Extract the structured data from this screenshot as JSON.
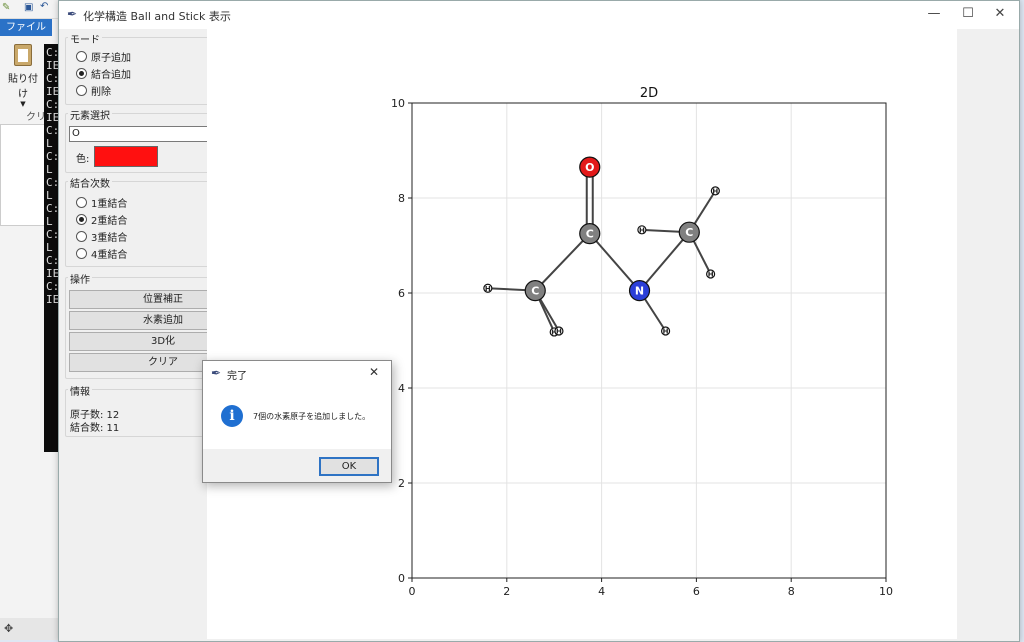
{
  "background_app": {
    "file_tab": "ファイル",
    "paste_label": "貼り付け",
    "clipboard_label": "クリッ"
  },
  "console": {
    "lines": [
      "C:",
      "IE",
      "C:",
      "IE",
      "C:",
      "IE",
      "C:",
      "L",
      "C:",
      "L",
      "C:",
      "L",
      "C:",
      "L",
      "C:",
      "L",
      "C:",
      "IE",
      "C:",
      "IE"
    ]
  },
  "window": {
    "title": "化学構造 Ball and Stick 表示",
    "minimize": "—",
    "maximize": "☐",
    "close": "✕"
  },
  "panel": {
    "mode": {
      "label": "モード",
      "options": [
        "原子追加",
        "結合追加",
        "削除"
      ],
      "selected": 1
    },
    "element": {
      "label": "元素選択",
      "value": "O",
      "color_label": "色:",
      "color": "#ff1010"
    },
    "bond": {
      "label": "結合次数",
      "options": [
        "1重結合",
        "2重結合",
        "3重結合",
        "4重結合"
      ],
      "selected": 1
    },
    "ops": {
      "label": "操作",
      "buttons": [
        "位置補正",
        "水素追加",
        "3D化",
        "クリア"
      ]
    },
    "info": {
      "label": "情報",
      "atoms": "原子数: 12",
      "bonds": "結合数: 11"
    }
  },
  "dialog": {
    "title": "完了",
    "message": "7個の水素原子を追加しました。",
    "ok": "OK",
    "close": "✕"
  },
  "chart_data": {
    "type": "scatter",
    "title": "2D",
    "xlim": [
      0,
      10
    ],
    "ylim": [
      0,
      10
    ],
    "xticks": [
      "0",
      "2",
      "4",
      "6",
      "8",
      "10"
    ],
    "yticks": [
      "0",
      "2",
      "4",
      "6",
      "8",
      "10"
    ],
    "grid": true,
    "atoms": [
      {
        "id": "O1",
        "el": "O",
        "x": 3.75,
        "y": 8.65,
        "color": "#e31a1a"
      },
      {
        "id": "C1",
        "el": "C",
        "x": 3.75,
        "y": 7.25,
        "color": "#808080"
      },
      {
        "id": "C2",
        "el": "C",
        "x": 2.6,
        "y": 6.05,
        "color": "#808080"
      },
      {
        "id": "N1",
        "el": "N",
        "x": 4.8,
        "y": 6.05,
        "color": "#2b3fd8"
      },
      {
        "id": "C3",
        "el": "C",
        "x": 5.85,
        "y": 7.28,
        "color": "#808080"
      },
      {
        "id": "H1",
        "el": "H",
        "x": 1.6,
        "y": 6.1,
        "color": "#ffffff"
      },
      {
        "id": "H2",
        "el": "H",
        "x": 3.0,
        "y": 5.18,
        "color": "#ffffff"
      },
      {
        "id": "H3",
        "el": "H",
        "x": 3.1,
        "y": 5.2,
        "color": "#ffffff"
      },
      {
        "id": "H4",
        "el": "H",
        "x": 5.35,
        "y": 5.2,
        "color": "#ffffff"
      },
      {
        "id": "H5",
        "el": "H",
        "x": 4.85,
        "y": 7.33,
        "color": "#ffffff"
      },
      {
        "id": "H6",
        "el": "H",
        "x": 6.4,
        "y": 8.15,
        "color": "#ffffff"
      },
      {
        "id": "H7",
        "el": "H",
        "x": 6.3,
        "y": 6.4,
        "color": "#ffffff"
      }
    ],
    "bonds": [
      {
        "a": "O1",
        "b": "C1",
        "order": 2
      },
      {
        "a": "C1",
        "b": "C2",
        "order": 1
      },
      {
        "a": "C1",
        "b": "N1",
        "order": 1
      },
      {
        "a": "N1",
        "b": "C3",
        "order": 1
      },
      {
        "a": "C2",
        "b": "H1",
        "order": 1
      },
      {
        "a": "C2",
        "b": "H2",
        "order": 1
      },
      {
        "a": "C2",
        "b": "H3",
        "order": 1
      },
      {
        "a": "N1",
        "b": "H4",
        "order": 1
      },
      {
        "a": "C3",
        "b": "H5",
        "order": 1
      },
      {
        "a": "C3",
        "b": "H6",
        "order": 1
      },
      {
        "a": "C3",
        "b": "H7",
        "order": 1
      }
    ]
  }
}
